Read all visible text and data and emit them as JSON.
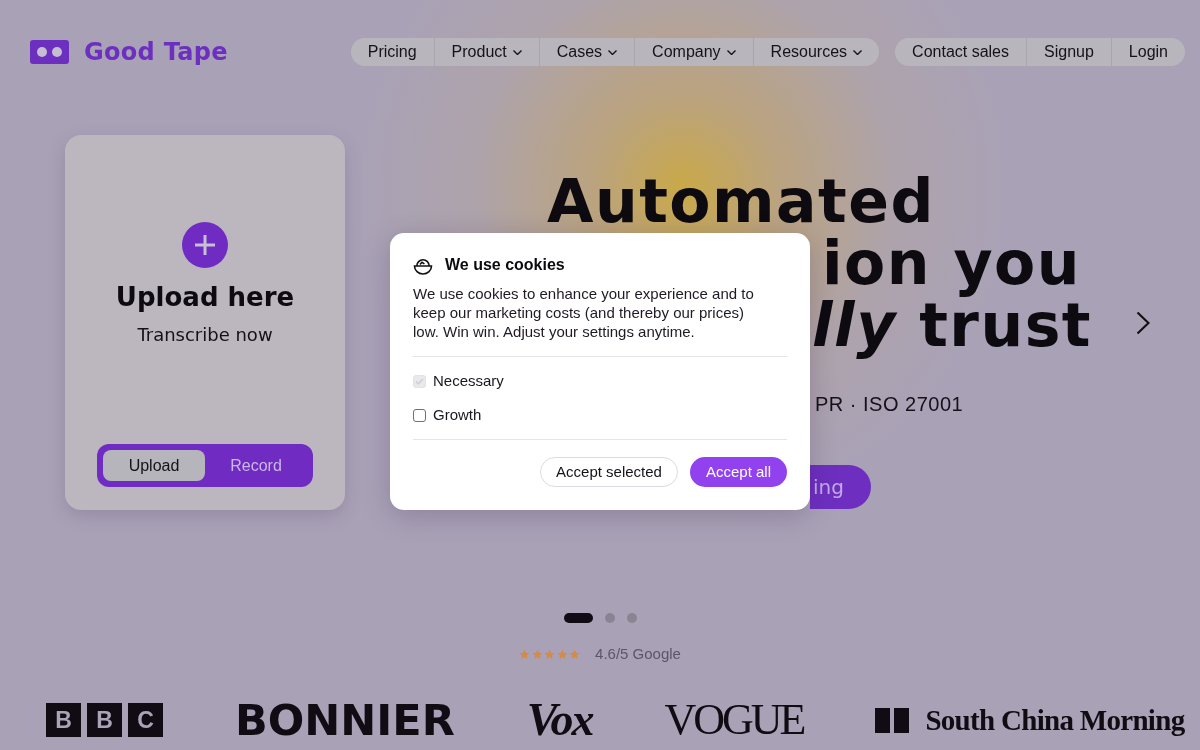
{
  "header": {
    "logo_text": "Good Tape",
    "nav": [
      {
        "label": "Pricing",
        "kind": "link"
      },
      {
        "label": "Product",
        "kind": "menu"
      },
      {
        "label": "Cases",
        "kind": "menu"
      },
      {
        "label": "Company",
        "kind": "menu"
      },
      {
        "label": "Resources",
        "kind": "menu"
      }
    ],
    "account_links": [
      "Contact sales",
      "Signup",
      "Login"
    ]
  },
  "upload_card": {
    "title": "Upload here",
    "subtitle": "Transcribe now",
    "mode_tabs": [
      {
        "label": "Upload",
        "selected": true
      },
      {
        "label": "Record",
        "selected": false
      }
    ]
  },
  "hero": {
    "headline": [
      "Automated",
      "ion you",
      "*lly* trust"
    ],
    "compliance": "PR · ISO 27001",
    "cta": "ing"
  },
  "slides": [
    {
      "selected": true
    },
    {
      "selected": false
    },
    {
      "selected": false
    }
  ],
  "rating": {
    "stars": 5,
    "text": "4.6/5 Google"
  },
  "press_logos": [
    {
      "kind": "boxed_letters",
      "letters": [
        "B",
        "B",
        "C"
      ]
    },
    {
      "kind": "bold_sans",
      "text": "BONNIER"
    },
    {
      "kind": "italic_serif",
      "text": "Vox"
    },
    {
      "kind": "condensed_serif",
      "text": "VOGUE"
    },
    {
      "kind": "blocks_serif",
      "text": "South China Morning"
    }
  ],
  "cookie_dialog": {
    "title": "We use cookies",
    "body": "We use cookies to enhance your experience and to keep our marketing costs (and thereby our prices) low. Win win. Adjust your settings anytime.",
    "options": [
      {
        "label": "Necessary",
        "checked": true,
        "disabled": true
      },
      {
        "label": "Growth",
        "checked": false,
        "disabled": false
      }
    ],
    "buttons": [
      {
        "label": "Accept selected",
        "kind": "outline"
      },
      {
        "label": "Accept all",
        "kind": "primary"
      }
    ]
  }
}
